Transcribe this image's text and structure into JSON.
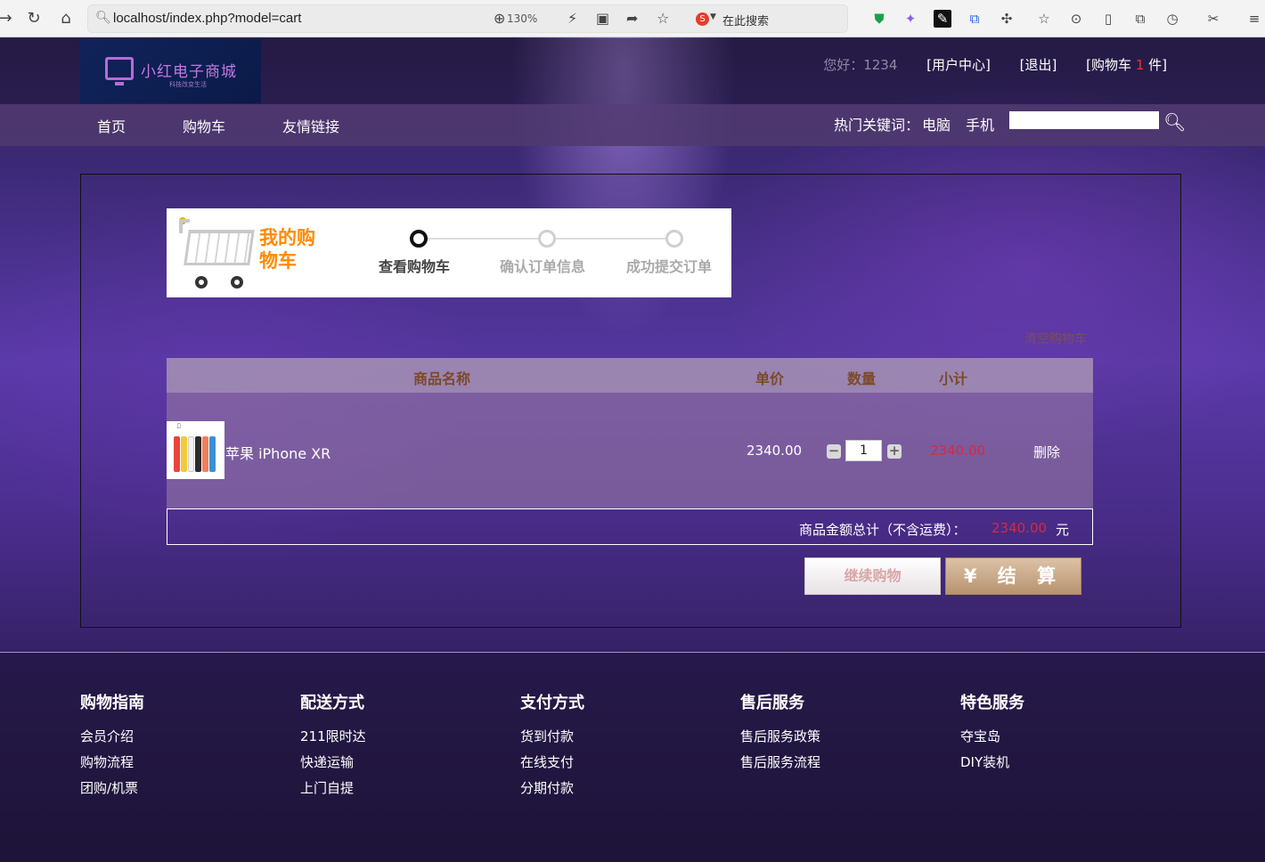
{
  "browser": {
    "url": "localhost/index.php?model=cart",
    "zoom": "130%",
    "search_engine_label": "在此搜索"
  },
  "header": {
    "logo_title": "小红电子商城",
    "logo_subtitle": "科技改变生活",
    "greeting": "您好：1234",
    "user_center": "[用户中心]",
    "logout": "[退出]",
    "cart_prefix": "[购物车",
    "cart_count": "1",
    "cart_suffix": "件]"
  },
  "nav": {
    "items": [
      {
        "label": "首页"
      },
      {
        "label": "购物车"
      },
      {
        "label": "友情链接"
      }
    ],
    "hot_label": "热门关键词：",
    "hot_keywords": [
      {
        "label": "电脑"
      },
      {
        "label": "手机"
      }
    ],
    "search_value": ""
  },
  "banner": {
    "title": "我的购物车",
    "steps": [
      {
        "label": "查看购物车",
        "active": true
      },
      {
        "label": "确认订单信息",
        "active": false
      },
      {
        "label": "成功提交订单",
        "active": false
      }
    ]
  },
  "cart": {
    "clear_label": "清空购物车",
    "columns": {
      "name": "商品名称",
      "price": "单价",
      "qty": "数量",
      "subtotal": "小计"
    },
    "items": [
      {
        "name": "苹果 iPhone XR",
        "price": "2340.00",
        "qty": "1",
        "subtotal": "2340.00",
        "delete_label": "删除"
      }
    ],
    "total_label": "商品金额总计（不含运费）：",
    "total_value": "2340.00",
    "total_unit": "元",
    "continue_label": "继续购物",
    "checkout_label": "¥ 结 算"
  },
  "footer": {
    "columns": [
      {
        "title": "购物指南",
        "items": [
          "会员介绍",
          "购物流程",
          "团购/机票"
        ]
      },
      {
        "title": "配送方式",
        "items": [
          "211限时达",
          "快递运输",
          "上门自提"
        ]
      },
      {
        "title": "支付方式",
        "items": [
          "货到付款",
          "在线支付",
          "分期付款"
        ]
      },
      {
        "title": "售后服务",
        "items": [
          "售后服务政策",
          "售后服务流程"
        ]
      },
      {
        "title": "特色服务",
        "items": [
          "夺宝岛",
          "DIY装机"
        ]
      }
    ]
  },
  "colors": {
    "accent_orange": "#ff8a00",
    "price_red": "#d42a43",
    "cart_count_red": "#ff2b2b"
  }
}
